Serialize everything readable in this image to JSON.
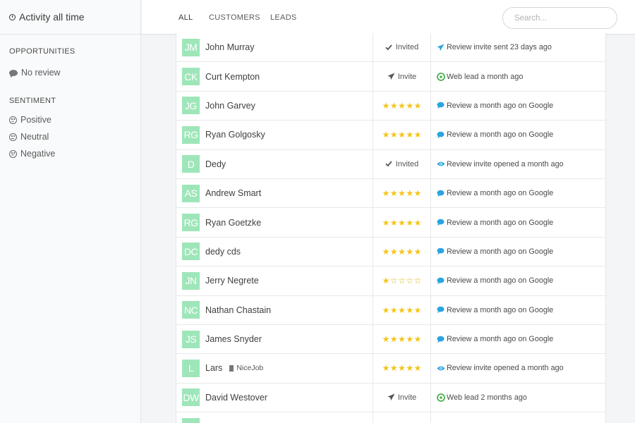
{
  "sidebar": {
    "title": "Activity all time",
    "opportunities_title": "OPPORTUNITIES",
    "no_review_label": "No review",
    "sentiment_title": "SENTIMENT",
    "sentiment_items": [
      {
        "label": "Positive",
        "icon": "smile-icon"
      },
      {
        "label": "Neutral",
        "icon": "neutral-face-icon"
      },
      {
        "label": "Negative",
        "icon": "frown-icon"
      }
    ]
  },
  "tabs": [
    {
      "label": "ALL",
      "active": true
    },
    {
      "label": "CUSTOMERS",
      "active": false
    },
    {
      "label": "LEADS",
      "active": false
    }
  ],
  "search": {
    "placeholder": "Search..."
  },
  "colors": {
    "accent": "#2aa4e0",
    "avatar": "#9ee6b9",
    "star": "#f3c516",
    "lead": "#4caf50"
  },
  "rows": [
    {
      "initials": "JM",
      "name": "John Murray",
      "status": "Invited",
      "status_icon": "check-icon",
      "activity": "Review invite sent 23 days ago",
      "activity_icon": "paper-plane-icon"
    },
    {
      "initials": "CK",
      "name": "Curt Kempton",
      "status": "Invite",
      "status_icon": "paper-plane-icon",
      "activity": "Web lead a month ago",
      "activity_icon": "target-icon"
    },
    {
      "initials": "JG",
      "name": "John Garvey",
      "rating": 5,
      "activity": "Review a month ago on Google",
      "activity_icon": "chat-bubble-icon"
    },
    {
      "initials": "RG",
      "name": "Ryan Golgosky",
      "rating": 5,
      "activity": "Review a month ago on Google",
      "activity_icon": "chat-bubble-icon"
    },
    {
      "initials": "D",
      "name": "Dedy",
      "status": "Invited",
      "status_icon": "check-icon",
      "activity": "Review invite opened a month ago",
      "activity_icon": "eye-icon"
    },
    {
      "initials": "AS",
      "name": "Andrew Smart",
      "rating": 5,
      "activity": "Review a month ago on Google",
      "activity_icon": "chat-bubble-icon"
    },
    {
      "initials": "RG",
      "name": "Ryan Goetzke",
      "rating": 5,
      "activity": "Review a month ago on Google",
      "activity_icon": "chat-bubble-icon"
    },
    {
      "initials": "DC",
      "name": "dedy cds",
      "rating": 5,
      "activity": "Review a month ago on Google",
      "activity_icon": "chat-bubble-icon"
    },
    {
      "initials": "JN",
      "name": "Jerry Negrete",
      "rating": 1,
      "activity": "Review a month ago on Google",
      "activity_icon": "chat-bubble-icon"
    },
    {
      "initials": "NC",
      "name": "Nathan Chastain",
      "rating": 5,
      "activity": "Review a month ago on Google",
      "activity_icon": "chat-bubble-icon"
    },
    {
      "initials": "JS",
      "name": "James Snyder",
      "rating": 5,
      "activity": "Review a month ago on Google",
      "activity_icon": "chat-bubble-icon"
    },
    {
      "initials": "L",
      "name": "Lars",
      "tag": "NiceJob",
      "rating": 5,
      "activity": "Review invite opened a month ago",
      "activity_icon": "eye-icon"
    },
    {
      "initials": "DW",
      "name": "David Westover",
      "status": "Invite",
      "status_icon": "paper-plane-icon",
      "activity": "Web lead 2 months ago",
      "activity_icon": "target-icon"
    },
    {
      "initials": "",
      "name": "",
      "activity": "",
      "activity_icon": ""
    }
  ]
}
